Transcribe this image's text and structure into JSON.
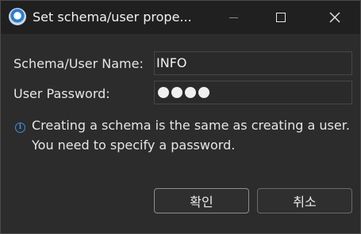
{
  "window": {
    "title": "Set schema/user prope..."
  },
  "icons": {
    "app": "app-logo-icon",
    "minimize": "minimize-icon",
    "maximize": "maximize-icon",
    "close": "close-icon",
    "info": "info-icon"
  },
  "form": {
    "name_label": "Schema/User Name:",
    "name_value": "INFO",
    "password_label": "User Password:",
    "password_length": 4
  },
  "info": {
    "line1": "Creating a schema is the same as creating a user.",
    "line2": "You need to specify a password."
  },
  "buttons": {
    "ok": "확인",
    "cancel": "취소"
  },
  "colors": {
    "background": "#2c2c2c",
    "titlebar": "#202020",
    "accent": "#3d8fe0"
  }
}
